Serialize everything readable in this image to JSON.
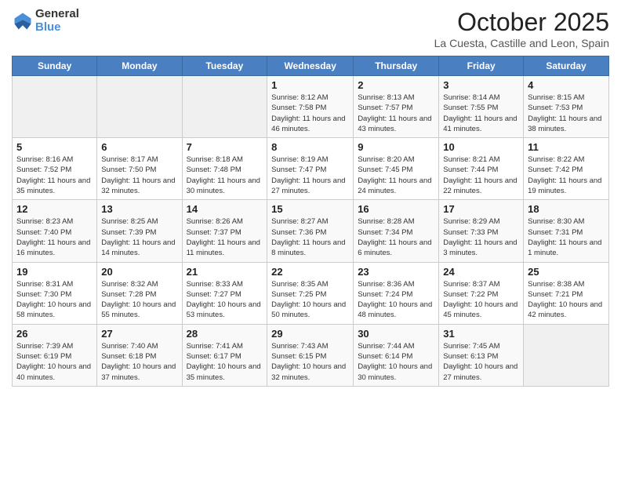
{
  "header": {
    "logo_general": "General",
    "logo_blue": "Blue",
    "month": "October 2025",
    "location": "La Cuesta, Castille and Leon, Spain"
  },
  "weekdays": [
    "Sunday",
    "Monday",
    "Tuesday",
    "Wednesday",
    "Thursday",
    "Friday",
    "Saturday"
  ],
  "weeks": [
    [
      {
        "day": "",
        "sunrise": "",
        "sunset": "",
        "daylight": ""
      },
      {
        "day": "",
        "sunrise": "",
        "sunset": "",
        "daylight": ""
      },
      {
        "day": "",
        "sunrise": "",
        "sunset": "",
        "daylight": ""
      },
      {
        "day": "1",
        "sunrise": "Sunrise: 8:12 AM",
        "sunset": "Sunset: 7:58 PM",
        "daylight": "Daylight: 11 hours and 46 minutes."
      },
      {
        "day": "2",
        "sunrise": "Sunrise: 8:13 AM",
        "sunset": "Sunset: 7:57 PM",
        "daylight": "Daylight: 11 hours and 43 minutes."
      },
      {
        "day": "3",
        "sunrise": "Sunrise: 8:14 AM",
        "sunset": "Sunset: 7:55 PM",
        "daylight": "Daylight: 11 hours and 41 minutes."
      },
      {
        "day": "4",
        "sunrise": "Sunrise: 8:15 AM",
        "sunset": "Sunset: 7:53 PM",
        "daylight": "Daylight: 11 hours and 38 minutes."
      }
    ],
    [
      {
        "day": "5",
        "sunrise": "Sunrise: 8:16 AM",
        "sunset": "Sunset: 7:52 PM",
        "daylight": "Daylight: 11 hours and 35 minutes."
      },
      {
        "day": "6",
        "sunrise": "Sunrise: 8:17 AM",
        "sunset": "Sunset: 7:50 PM",
        "daylight": "Daylight: 11 hours and 32 minutes."
      },
      {
        "day": "7",
        "sunrise": "Sunrise: 8:18 AM",
        "sunset": "Sunset: 7:48 PM",
        "daylight": "Daylight: 11 hours and 30 minutes."
      },
      {
        "day": "8",
        "sunrise": "Sunrise: 8:19 AM",
        "sunset": "Sunset: 7:47 PM",
        "daylight": "Daylight: 11 hours and 27 minutes."
      },
      {
        "day": "9",
        "sunrise": "Sunrise: 8:20 AM",
        "sunset": "Sunset: 7:45 PM",
        "daylight": "Daylight: 11 hours and 24 minutes."
      },
      {
        "day": "10",
        "sunrise": "Sunrise: 8:21 AM",
        "sunset": "Sunset: 7:44 PM",
        "daylight": "Daylight: 11 hours and 22 minutes."
      },
      {
        "day": "11",
        "sunrise": "Sunrise: 8:22 AM",
        "sunset": "Sunset: 7:42 PM",
        "daylight": "Daylight: 11 hours and 19 minutes."
      }
    ],
    [
      {
        "day": "12",
        "sunrise": "Sunrise: 8:23 AM",
        "sunset": "Sunset: 7:40 PM",
        "daylight": "Daylight: 11 hours and 16 minutes."
      },
      {
        "day": "13",
        "sunrise": "Sunrise: 8:25 AM",
        "sunset": "Sunset: 7:39 PM",
        "daylight": "Daylight: 11 hours and 14 minutes."
      },
      {
        "day": "14",
        "sunrise": "Sunrise: 8:26 AM",
        "sunset": "Sunset: 7:37 PM",
        "daylight": "Daylight: 11 hours and 11 minutes."
      },
      {
        "day": "15",
        "sunrise": "Sunrise: 8:27 AM",
        "sunset": "Sunset: 7:36 PM",
        "daylight": "Daylight: 11 hours and 8 minutes."
      },
      {
        "day": "16",
        "sunrise": "Sunrise: 8:28 AM",
        "sunset": "Sunset: 7:34 PM",
        "daylight": "Daylight: 11 hours and 6 minutes."
      },
      {
        "day": "17",
        "sunrise": "Sunrise: 8:29 AM",
        "sunset": "Sunset: 7:33 PM",
        "daylight": "Daylight: 11 hours and 3 minutes."
      },
      {
        "day": "18",
        "sunrise": "Sunrise: 8:30 AM",
        "sunset": "Sunset: 7:31 PM",
        "daylight": "Daylight: 11 hours and 1 minute."
      }
    ],
    [
      {
        "day": "19",
        "sunrise": "Sunrise: 8:31 AM",
        "sunset": "Sunset: 7:30 PM",
        "daylight": "Daylight: 10 hours and 58 minutes."
      },
      {
        "day": "20",
        "sunrise": "Sunrise: 8:32 AM",
        "sunset": "Sunset: 7:28 PM",
        "daylight": "Daylight: 10 hours and 55 minutes."
      },
      {
        "day": "21",
        "sunrise": "Sunrise: 8:33 AM",
        "sunset": "Sunset: 7:27 PM",
        "daylight": "Daylight: 10 hours and 53 minutes."
      },
      {
        "day": "22",
        "sunrise": "Sunrise: 8:35 AM",
        "sunset": "Sunset: 7:25 PM",
        "daylight": "Daylight: 10 hours and 50 minutes."
      },
      {
        "day": "23",
        "sunrise": "Sunrise: 8:36 AM",
        "sunset": "Sunset: 7:24 PM",
        "daylight": "Daylight: 10 hours and 48 minutes."
      },
      {
        "day": "24",
        "sunrise": "Sunrise: 8:37 AM",
        "sunset": "Sunset: 7:22 PM",
        "daylight": "Daylight: 10 hours and 45 minutes."
      },
      {
        "day": "25",
        "sunrise": "Sunrise: 8:38 AM",
        "sunset": "Sunset: 7:21 PM",
        "daylight": "Daylight: 10 hours and 42 minutes."
      }
    ],
    [
      {
        "day": "26",
        "sunrise": "Sunrise: 7:39 AM",
        "sunset": "Sunset: 6:19 PM",
        "daylight": "Daylight: 10 hours and 40 minutes."
      },
      {
        "day": "27",
        "sunrise": "Sunrise: 7:40 AM",
        "sunset": "Sunset: 6:18 PM",
        "daylight": "Daylight: 10 hours and 37 minutes."
      },
      {
        "day": "28",
        "sunrise": "Sunrise: 7:41 AM",
        "sunset": "Sunset: 6:17 PM",
        "daylight": "Daylight: 10 hours and 35 minutes."
      },
      {
        "day": "29",
        "sunrise": "Sunrise: 7:43 AM",
        "sunset": "Sunset: 6:15 PM",
        "daylight": "Daylight: 10 hours and 32 minutes."
      },
      {
        "day": "30",
        "sunrise": "Sunrise: 7:44 AM",
        "sunset": "Sunset: 6:14 PM",
        "daylight": "Daylight: 10 hours and 30 minutes."
      },
      {
        "day": "31",
        "sunrise": "Sunrise: 7:45 AM",
        "sunset": "Sunset: 6:13 PM",
        "daylight": "Daylight: 10 hours and 27 minutes."
      },
      {
        "day": "",
        "sunrise": "",
        "sunset": "",
        "daylight": ""
      }
    ]
  ]
}
